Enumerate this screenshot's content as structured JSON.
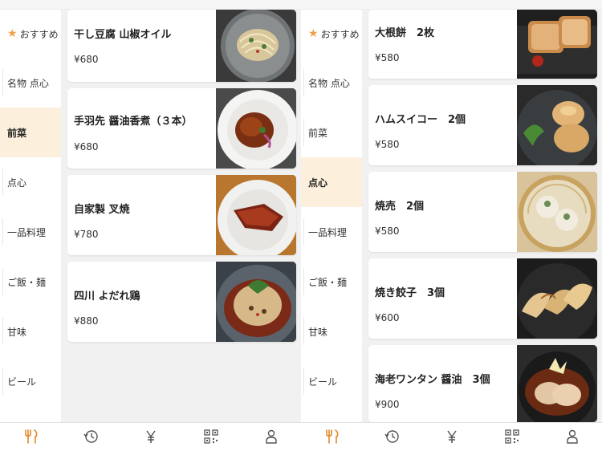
{
  "colors": {
    "accent": "#f0a04b",
    "active_category_bg": "#fcefdc",
    "background": "#f1f1f1"
  },
  "left_panel": {
    "sidebar": [
      {
        "label": "おすすめ",
        "icon": "star-icon",
        "active": false
      },
      {
        "label": "名物 点心",
        "active": false
      },
      {
        "label": "前菜",
        "active": true
      },
      {
        "label": "点心",
        "active": false
      },
      {
        "label": "一品料理",
        "active": false
      },
      {
        "label": "ご飯・麺",
        "active": false
      },
      {
        "label": "甘味",
        "active": false
      },
      {
        "label": "ビール",
        "active": false
      }
    ],
    "items": [
      {
        "name": "干し豆腐 山椒オイル",
        "price": "¥680",
        "photo": "dish-photo-noodles"
      },
      {
        "name": "手羽先 醤油香煮（３本）",
        "price": "¥680",
        "photo": "dish-photo-chicken-wings"
      },
      {
        "name": "自家製 叉焼",
        "price": "¥780",
        "photo": "dish-photo-char-siu"
      },
      {
        "name": "四川 よだれ鶏",
        "price": "¥880",
        "photo": "dish-photo-drool-chicken"
      }
    ]
  },
  "right_panel": {
    "sidebar": [
      {
        "label": "おすすめ",
        "icon": "star-icon",
        "active": false
      },
      {
        "label": "名物 点心",
        "active": false
      },
      {
        "label": "前菜",
        "active": false
      },
      {
        "label": "点心",
        "active": true
      },
      {
        "label": "一品料理",
        "active": false
      },
      {
        "label": "ご飯・麺",
        "active": false
      },
      {
        "label": "甘味",
        "active": false
      },
      {
        "label": "ビール",
        "active": false
      }
    ],
    "items": [
      {
        "name": "大根餅　2枚",
        "price": "¥580",
        "photo": "dish-photo-turnip-cake"
      },
      {
        "name": "ハムスイコー　2個",
        "price": "¥580",
        "photo": "dish-photo-ham-sui-gok"
      },
      {
        "name": "焼売　2個",
        "price": "¥580",
        "photo": "dish-photo-shumai"
      },
      {
        "name": "焼き餃子　3個",
        "price": "¥600",
        "photo": "dish-photo-gyoza"
      },
      {
        "name": "海老ワンタン 醤油　3個",
        "price": "¥900",
        "photo": "dish-photo-shrimp-wonton"
      }
    ]
  },
  "tabbar": [
    {
      "icon": "fork-knife-icon",
      "active": true
    },
    {
      "icon": "history-icon",
      "active": false
    },
    {
      "icon": "yen-icon",
      "active": false
    },
    {
      "icon": "qr-code-icon",
      "active": false
    },
    {
      "icon": "user-icon",
      "active": false
    }
  ]
}
